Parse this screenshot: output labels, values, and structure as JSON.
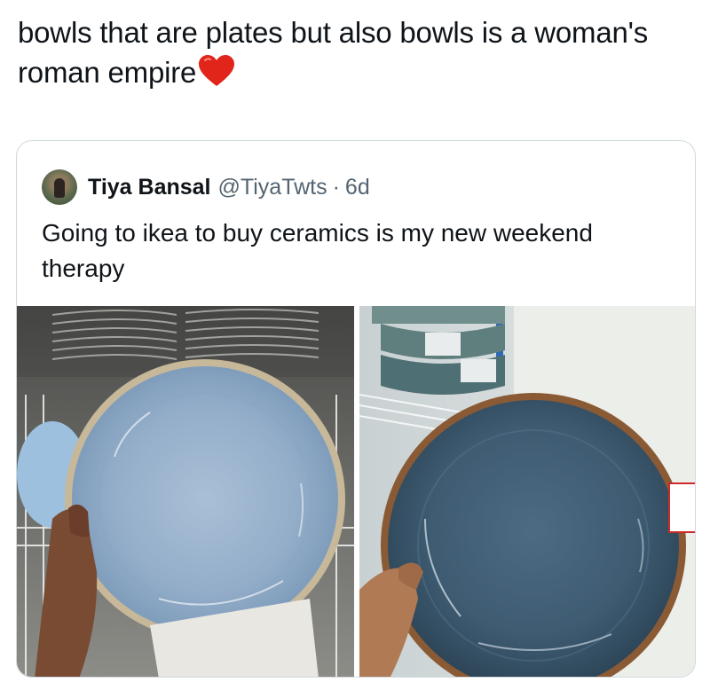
{
  "tweet": {
    "text": "bowls that are plates but also bowls is a woman's roman empire",
    "emoji": "red-heart-emoji"
  },
  "quoted_tweet": {
    "name": "Tiya Bansal",
    "handle": "@TiyaTwts",
    "separator": "·",
    "time": "6d",
    "text": "Going to ikea to buy ceramics is my new weekend therapy"
  },
  "media": {
    "photos": [
      {
        "subject": "light-blue-ceramic-plate-photo",
        "plate_color": "#93adc9"
      },
      {
        "subject": "dark-blue-speckled-bowl-photo",
        "plate_color": "#3e5b72"
      }
    ]
  }
}
